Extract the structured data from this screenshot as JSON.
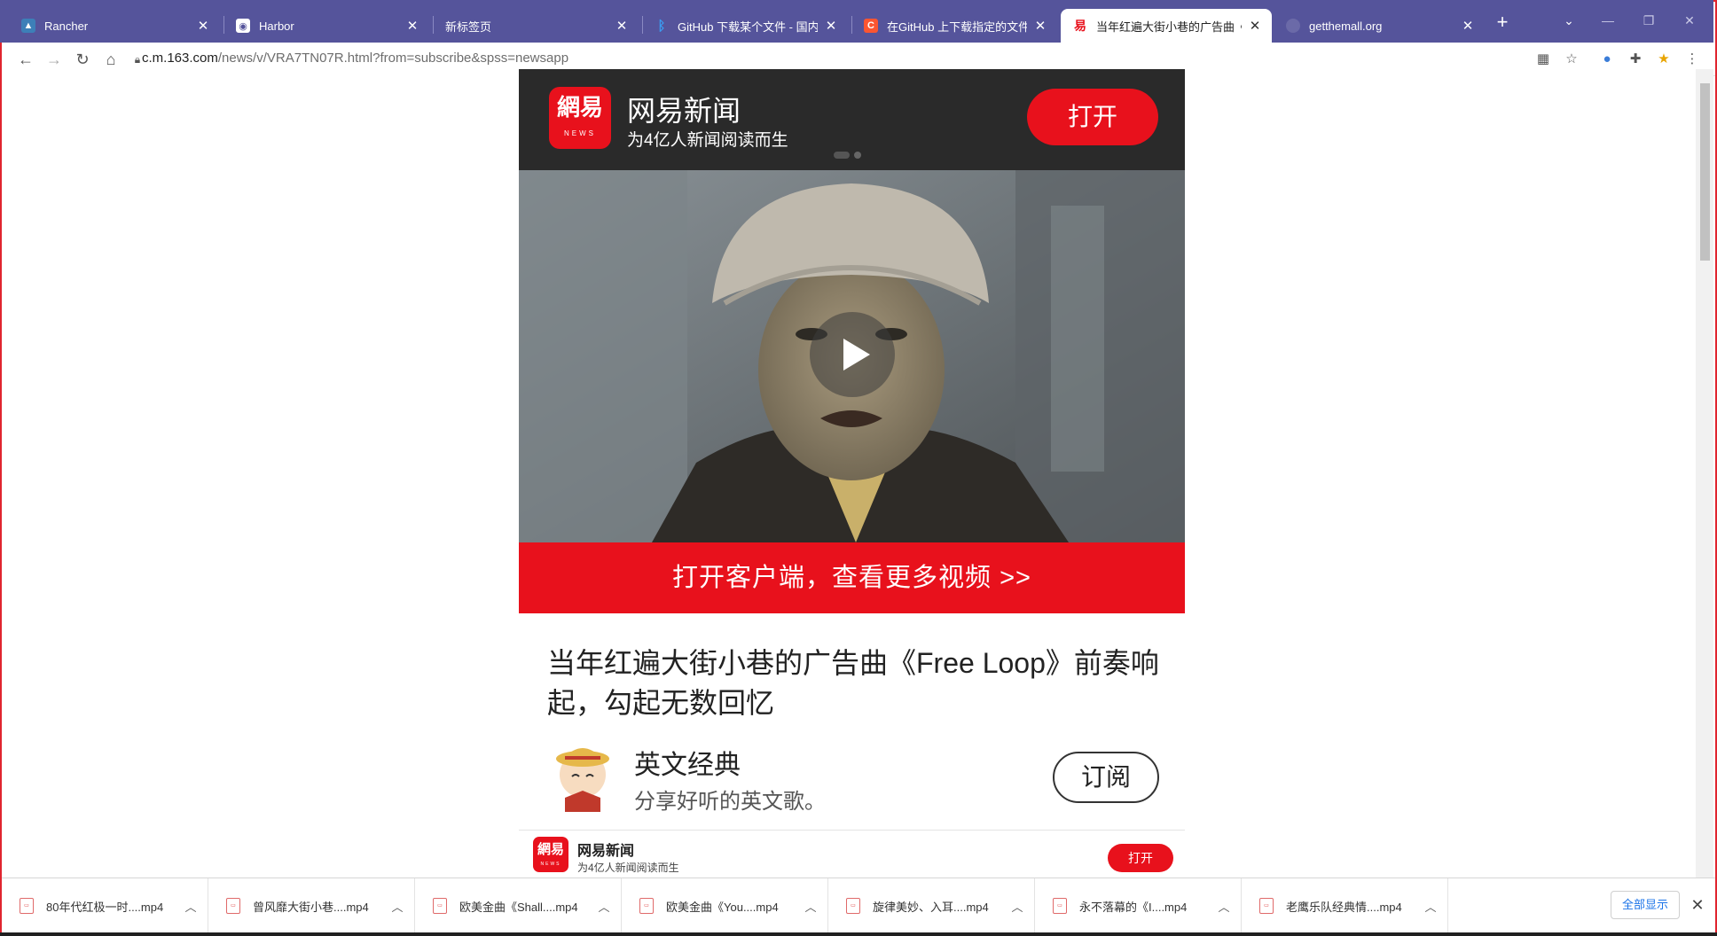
{
  "browser": {
    "tabs": [
      {
        "title": "Rancher",
        "favicon": "rancher-icon",
        "active": false
      },
      {
        "title": "Harbor",
        "favicon": "harbor-icon",
        "active": false
      },
      {
        "title": "新标签页",
        "favicon": "",
        "active": false
      },
      {
        "title": "GitHub 下载某个文件 - 国内版 B",
        "favicon": "bing-icon",
        "active": false
      },
      {
        "title": "在GitHub 上下载指定的文件夹",
        "favicon": "csdn-icon",
        "active": false
      },
      {
        "title": "当年红遍大街小巷的广告曲《Fr",
        "favicon": "netease-icon",
        "active": true
      },
      {
        "title": "getthemall.org",
        "favicon": "globe-icon",
        "active": false
      }
    ],
    "new_tab_label": "+",
    "url_host": "c.m.163.com",
    "url_rest": "/news/v/VRA7TN07R.html?from=subscribe&spss=newsapp"
  },
  "banner": {
    "logo_text": "網易",
    "logo_sub": "NEWS",
    "app_name": "网易新闻",
    "slogan": "为4亿人新闻阅读而生",
    "open_label": "打开"
  },
  "video": {
    "cta": "打开客户端，查看更多视频 >>"
  },
  "article": {
    "headline": "当年红遍大街小巷的广告曲《Free Loop》前奏响起，勾起无数回忆",
    "author_name": "英文经典",
    "author_desc": "分享好听的英文歌。",
    "subscribe_label": "订阅"
  },
  "footer_bar": {
    "app_name": "网易新闻",
    "slogan": "为4亿人新闻阅读而生",
    "open_label": "打开"
  },
  "downloads": {
    "items": [
      "80年代红极一时....mp4",
      "曾风靡大街小巷....mp4",
      "欧美金曲《Shall....mp4",
      "欧美金曲《You....mp4",
      "旋律美妙、入耳....mp4",
      "永不落幕的《I....mp4",
      "老鹰乐队经典情....mp4"
    ],
    "show_all": "全部显示"
  },
  "colors": {
    "tab_strip": "#55549b",
    "netease_red": "#e8111c",
    "banner_dark": "#2a2a2a"
  }
}
